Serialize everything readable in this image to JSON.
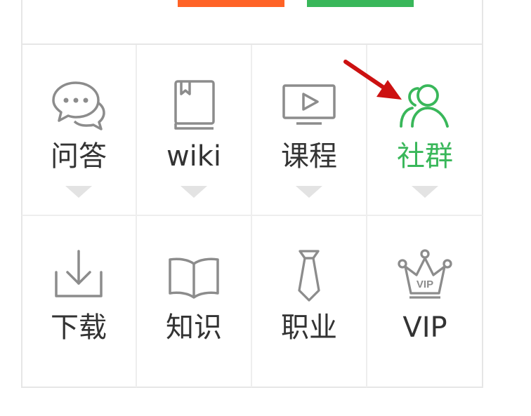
{
  "top_buttons": [
    {
      "name": "orange-button",
      "color": "#ff6326"
    },
    {
      "name": "green-button",
      "color": "#39b75a"
    }
  ],
  "menu": {
    "rows": [
      [
        {
          "label": "问答",
          "icon": "chat-bubbles-icon",
          "active": false,
          "caret": true
        },
        {
          "label": "wiki",
          "icon": "book-icon",
          "active": false,
          "caret": true
        },
        {
          "label": "课程",
          "icon": "video-play-icon",
          "active": false,
          "caret": true
        },
        {
          "label": "社群",
          "icon": "community-users-icon",
          "active": true,
          "caret": true
        }
      ],
      [
        {
          "label": "下载",
          "icon": "download-icon",
          "active": false,
          "caret": false
        },
        {
          "label": "知识",
          "icon": "open-book-icon",
          "active": false,
          "caret": false
        },
        {
          "label": "职业",
          "icon": "necktie-icon",
          "active": false,
          "caret": false
        },
        {
          "label": "VIP",
          "icon": "vip-crown-icon",
          "active": false,
          "caret": false
        }
      ]
    ]
  },
  "colors": {
    "icon_default": "#8c8c8c",
    "text_default": "#333333",
    "active": "#39b75a",
    "arrow": "#cc1111"
  },
  "annotation": {
    "type": "arrow",
    "points_to": "社群",
    "icon": "red-arrow-icon"
  }
}
